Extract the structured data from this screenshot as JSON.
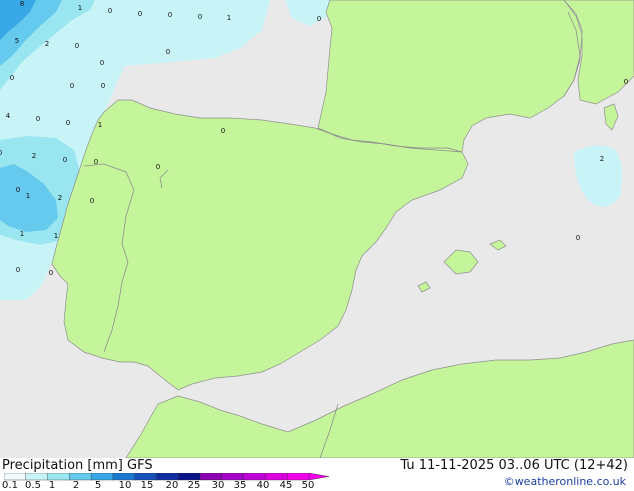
{
  "map": {
    "land_color": "#c5f59a",
    "sea_color": "#e9e9e9",
    "border_color": "#8f8f8f",
    "precip_light_color": "#c8f4f8",
    "precip_mid_color": "#99e6f0",
    "precip_heavy_color": "#66c9ee",
    "precip_max_color": "#38a8e6",
    "labels": [
      "8",
      "1",
      "0",
      "0",
      "0",
      "0",
      "1",
      "0",
      "5",
      "2",
      "0",
      "0",
      "0",
      "0",
      "0",
      "4",
      "0",
      "0",
      "1",
      "0",
      "0",
      "0",
      "0",
      "2",
      "2",
      "0",
      "0",
      "1",
      "2",
      "0",
      "1",
      "1",
      "0",
      "0",
      "0",
      "0",
      "0"
    ]
  },
  "footer": {
    "title": "Precipitation [mm] GFS",
    "time": "Tu 11-11-2025 03..06 UTC (12+42)",
    "credit": "©weatheronline.co.uk"
  },
  "scale": {
    "colors": [
      "#f2fbfd",
      "#c8f4f8",
      "#99e6f0",
      "#66c9ee",
      "#38a8e6",
      "#1a78d0",
      "#1450b8",
      "#0e2ea0",
      "#0a1488",
      "#8a00b0",
      "#a400c8",
      "#c000d8",
      "#dc00e0",
      "#f000e8"
    ],
    "ticks": [
      "0.1",
      "0.5",
      "1",
      "2",
      "5",
      "10",
      "15",
      "20",
      "25",
      "30",
      "35",
      "40",
      "45",
      "50"
    ]
  }
}
